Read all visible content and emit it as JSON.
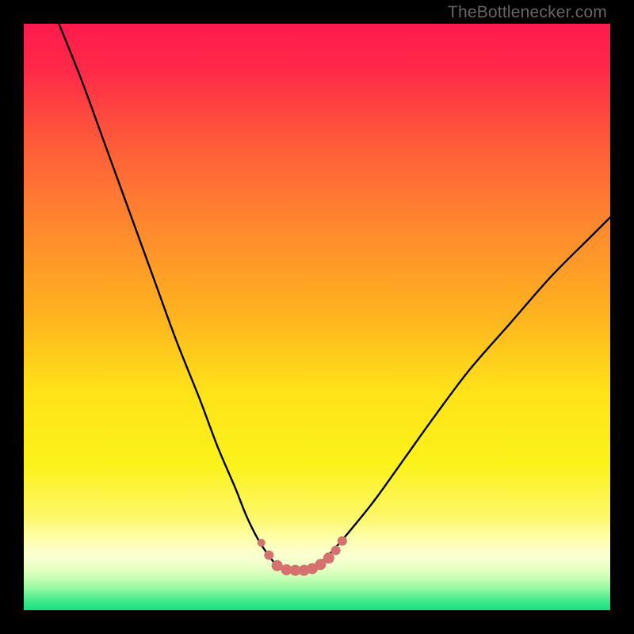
{
  "watermark": "TheBottlenecker.com",
  "gradient": {
    "stops": [
      {
        "offset": 0.0,
        "color": "#ff1a4d"
      },
      {
        "offset": 0.08,
        "color": "#ff2a49"
      },
      {
        "offset": 0.2,
        "color": "#ff5a3a"
      },
      {
        "offset": 0.35,
        "color": "#ff8a2e"
      },
      {
        "offset": 0.5,
        "color": "#ffb41f"
      },
      {
        "offset": 0.63,
        "color": "#ffe319"
      },
      {
        "offset": 0.75,
        "color": "#fbf21a"
      },
      {
        "offset": 0.84,
        "color": "#fdf768"
      },
      {
        "offset": 0.88,
        "color": "#feffb0"
      },
      {
        "offset": 0.905,
        "color": "#fbffd0"
      },
      {
        "offset": 0.925,
        "color": "#edffc8"
      },
      {
        "offset": 0.945,
        "color": "#c8ffb4"
      },
      {
        "offset": 0.965,
        "color": "#8cf7a0"
      },
      {
        "offset": 0.985,
        "color": "#3fe98b"
      },
      {
        "offset": 1.0,
        "color": "#18df80"
      }
    ]
  },
  "chart_data": {
    "type": "line",
    "title": "",
    "xlabel": "",
    "ylabel": "",
    "xlim": [
      0,
      100
    ],
    "ylim": [
      0,
      100
    ],
    "note": "Values are percentages of the plot area; x left→right, y is 0 at bottom, 100 at top. Curve shape is a bottleneck V with a small flat floor, plus discrete markers near the trough.",
    "series": [
      {
        "name": "bottleneck-curve",
        "x": [
          6,
          10,
          14,
          18,
          22,
          26,
          30,
          33,
          36,
          38,
          40,
          42,
          43.5,
          45,
          47,
          49,
          51,
          53,
          56,
          60,
          65,
          70,
          76,
          83,
          90,
          97,
          100
        ],
        "y": [
          100,
          90,
          79,
          68,
          57,
          46,
          36,
          28,
          21,
          16,
          12,
          9,
          7.3,
          6.8,
          6.8,
          7.2,
          8.5,
          10.5,
          14,
          19,
          26,
          33,
          41,
          49,
          57,
          64,
          67
        ]
      }
    ],
    "markers": {
      "name": "trough-points",
      "color": "#d5726f",
      "points": [
        {
          "x": 40.5,
          "y": 11.5,
          "r": 5
        },
        {
          "x": 41.8,
          "y": 9.4,
          "r": 6
        },
        {
          "x": 43.2,
          "y": 7.6,
          "r": 7
        },
        {
          "x": 44.8,
          "y": 6.9,
          "r": 7
        },
        {
          "x": 46.3,
          "y": 6.8,
          "r": 7
        },
        {
          "x": 47.8,
          "y": 6.8,
          "r": 7
        },
        {
          "x": 49.2,
          "y": 7.1,
          "r": 7
        },
        {
          "x": 50.6,
          "y": 7.8,
          "r": 7
        },
        {
          "x": 52.0,
          "y": 8.9,
          "r": 7
        },
        {
          "x": 53.2,
          "y": 10.2,
          "r": 6
        },
        {
          "x": 54.3,
          "y": 11.8,
          "r": 6
        }
      ]
    }
  }
}
